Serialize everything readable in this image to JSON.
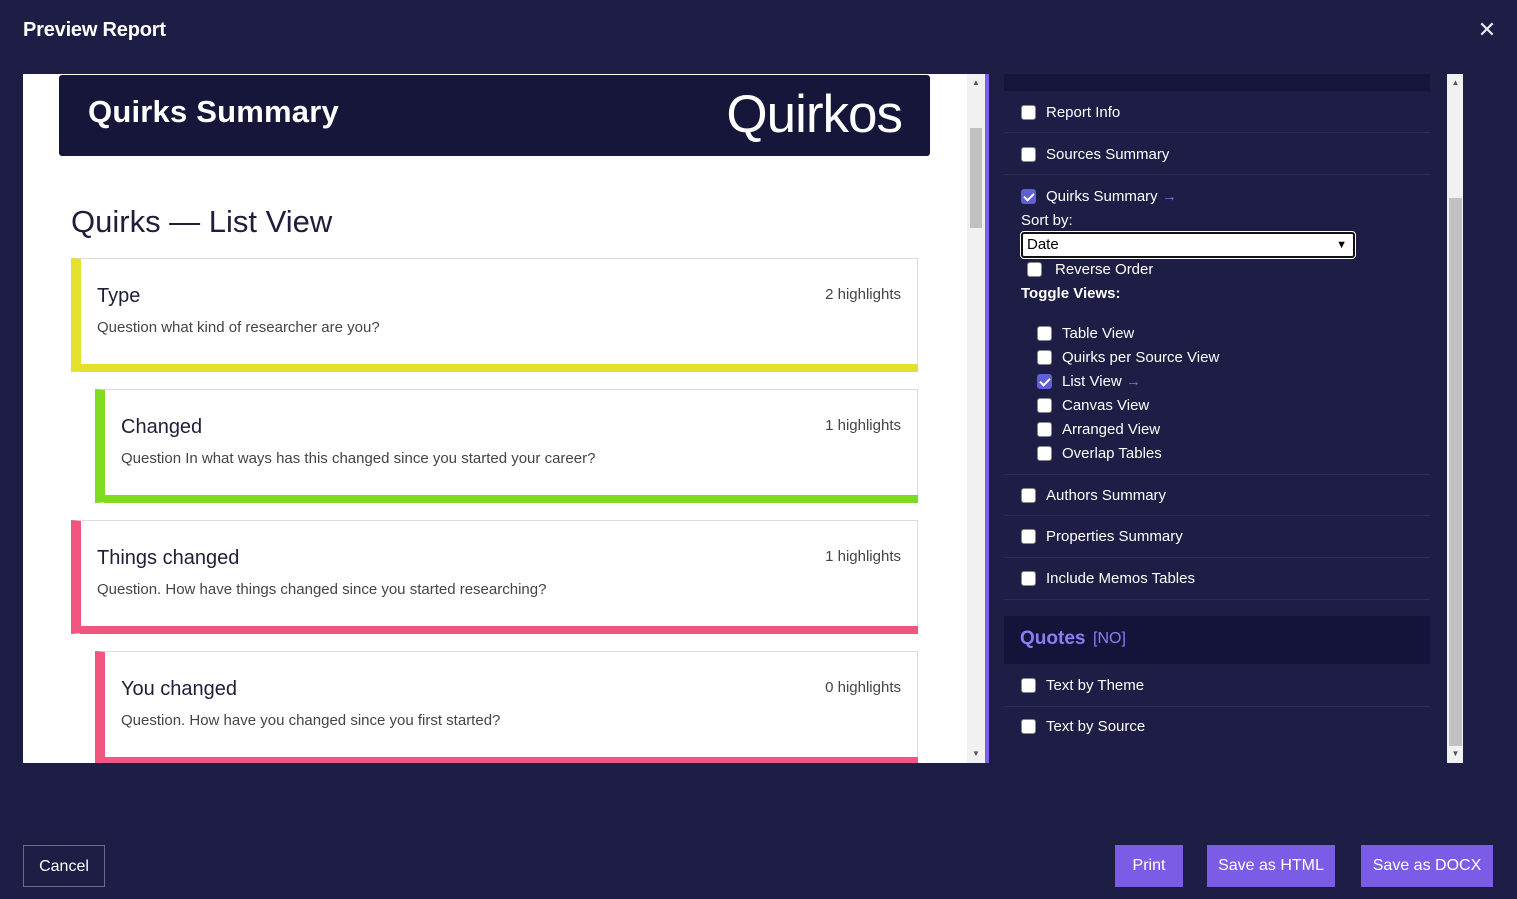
{
  "dialog": {
    "title": "Preview Report",
    "close_glyph": "✕"
  },
  "report": {
    "header_title": "Quirks Summary",
    "logo_text": "Quirkos",
    "list_heading": "Quirks — List View",
    "quirks": [
      {
        "title": "Type",
        "count": "2 highlights",
        "question": "Question what kind of researcher are you?",
        "color": "#e3e12e",
        "indent": 0
      },
      {
        "title": "Changed",
        "count": "1 highlights",
        "question": "Question In what ways has this changed since you started your career?",
        "color": "#7fdb1f",
        "indent": 1
      },
      {
        "title": "Things changed",
        "count": "1 highlights",
        "question": "Question. How have things changed since you started researching?",
        "color": "#f2557f",
        "indent": 0
      },
      {
        "title": "You changed",
        "count": "0 highlights",
        "question": "Question. How have you changed since you first started?",
        "color": "#f2557f",
        "indent": 1
      }
    ]
  },
  "options": {
    "report_info": {
      "label": "Report Info",
      "checked": false
    },
    "sources_summary": {
      "label": "Sources Summary",
      "checked": false
    },
    "quirks_summary": {
      "label": "Quirks Summary",
      "arrow": "→",
      "checked": true
    },
    "sort_by_label": "Sort by:",
    "sort_by_value": "Date",
    "reverse_order": {
      "label": "Reverse Order",
      "checked": false
    },
    "toggle_views_label": "Toggle Views:",
    "views": [
      {
        "label": "Table View",
        "checked": false
      },
      {
        "label": "Quirks per Source View",
        "checked": false
      },
      {
        "label": "List View",
        "arrow": "→",
        "checked": true
      },
      {
        "label": "Canvas View",
        "checked": false
      },
      {
        "label": "Arranged View",
        "checked": false
      },
      {
        "label": "Overlap Tables",
        "checked": false
      }
    ],
    "authors_summary": {
      "label": "Authors Summary",
      "checked": false
    },
    "properties_summary": {
      "label": "Properties Summary",
      "checked": false
    },
    "include_memos": {
      "label": "Include Memos Tables",
      "checked": false
    },
    "quotes_title": "Quotes",
    "quotes_tag": "[NO]",
    "text_by_theme": {
      "label": "Text by Theme",
      "checked": false
    },
    "text_by_source": {
      "label": "Text by Source",
      "checked": false
    }
  },
  "footer": {
    "cancel": "Cancel",
    "print": "Print",
    "save_html": "Save as HTML",
    "save_docx": "Save as DOCX"
  },
  "colors": {
    "accent": "#7b5ce6",
    "background": "#1d1d45",
    "header_bg": "#16163a"
  }
}
